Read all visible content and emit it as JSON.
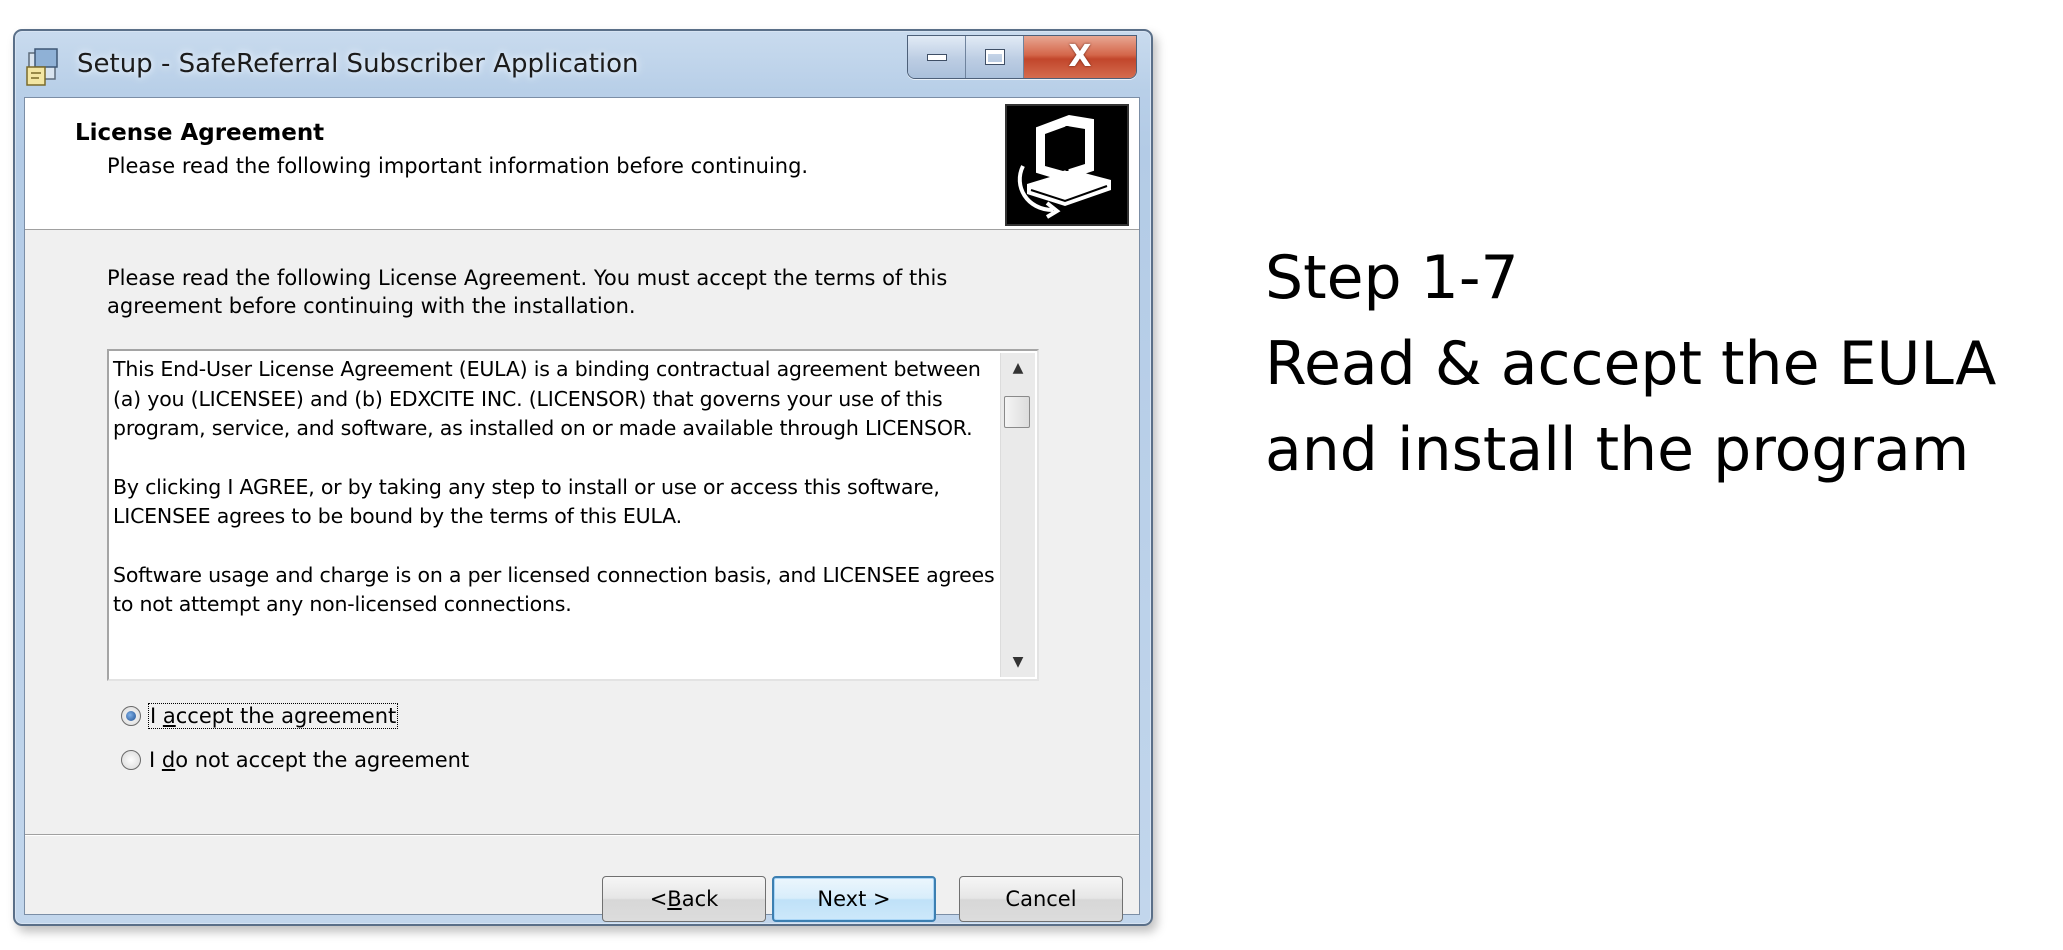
{
  "window": {
    "title": "Setup - SafeReferral Subscriber Application",
    "caption_buttons": {
      "minimize": "minimize",
      "maximize": "maximize",
      "close": "X"
    }
  },
  "header": {
    "title": "License Agreement",
    "subtitle": "Please read the following important information before continuing."
  },
  "intro_lines": [
    "Please read the following License Agreement. You must accept the terms of this",
    "agreement before continuing with the installation."
  ],
  "license_paragraphs": [
    "This End-User License Agreement (EULA) is a binding contractual agreement between (a) you (LICENSEE) and (b) EDXCITE INC. (LICENSOR) that governs your use of this program, service, and software, as installed on or made available through LICENSOR.",
    "By clicking I AGREE, or by taking any step to install or use or access this software, LICENSEE agrees to be bound by the terms of this EULA.",
    "Software usage and charge is on a per licensed connection basis, and LICENSEE agrees to not attempt any non-licensed connections."
  ],
  "radios": {
    "accept": {
      "prefix": "I ",
      "mnemonic": "a",
      "rest": "ccept the agreement",
      "selected": true
    },
    "decline": {
      "prefix": "I ",
      "mnemonic": "d",
      "rest": "o not accept the agreement",
      "selected": false
    }
  },
  "buttons": {
    "back": {
      "prefix": "< ",
      "mnemonic": "B",
      "rest": "ack"
    },
    "next": "Next >",
    "cancel": "Cancel"
  },
  "caption": {
    "line1": "Step 1-7",
    "line2": "Read & accept the EULA",
    "line3": "and install the program"
  },
  "colors": {
    "default_button_border": "#3c7fb1",
    "close_button": "#c2462b",
    "client_background": "#f0f0f0"
  }
}
